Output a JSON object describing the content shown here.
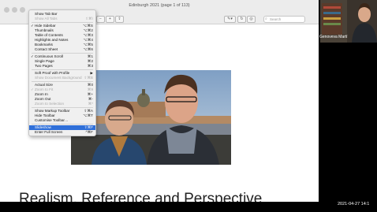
{
  "window": {
    "title": "Edinburgh 2021 (page 1 of 113)",
    "search_placeholder": "Search",
    "toolbar_pen": "✎▾"
  },
  "view_menu": {
    "items": [
      {
        "label": "Show Tab Bar",
        "shortcut": "",
        "checked": false,
        "disabled": false,
        "highlighted": false
      },
      {
        "label": "Show All Tabs",
        "shortcut": "⇧⌘\\",
        "checked": false,
        "disabled": true,
        "highlighted": false
      },
      {
        "label": "Hide Sidebar",
        "shortcut": "⌥⌘S",
        "checked": true,
        "disabled": false,
        "highlighted": false
      },
      {
        "label": "Thumbnails",
        "shortcut": "⌥⌘2",
        "checked": false,
        "disabled": false,
        "highlighted": false
      },
      {
        "label": "Table of Contents",
        "shortcut": "⌥⌘3",
        "checked": false,
        "disabled": false,
        "highlighted": false
      },
      {
        "label": "Highlights and Notes",
        "shortcut": "⌥⌘4",
        "checked": false,
        "disabled": false,
        "highlighted": false
      },
      {
        "label": "Bookmarks",
        "shortcut": "⌥⌘5",
        "checked": false,
        "disabled": false,
        "highlighted": false
      },
      {
        "label": "Contact Sheet",
        "shortcut": "⌥⌘6",
        "checked": false,
        "disabled": false,
        "highlighted": false
      },
      {
        "label": "Continuous Scroll",
        "shortcut": "⌘1",
        "checked": true,
        "disabled": false,
        "highlighted": false
      },
      {
        "label": "Single Page",
        "shortcut": "⌘2",
        "checked": false,
        "disabled": false,
        "highlighted": false
      },
      {
        "label": "Two Pages",
        "shortcut": "⌘3",
        "checked": false,
        "disabled": false,
        "highlighted": false
      },
      {
        "label": "Soft Proof with Profile",
        "shortcut": "▶",
        "checked": false,
        "disabled": false,
        "highlighted": false
      },
      {
        "label": "Show Document Background",
        "shortcut": "⇧⌘B",
        "checked": false,
        "disabled": true,
        "highlighted": false
      },
      {
        "label": "Actual Size",
        "shortcut": "⌘0",
        "checked": false,
        "disabled": false,
        "highlighted": false
      },
      {
        "label": "Zoom to Fit",
        "shortcut": "⌘9",
        "checked": true,
        "disabled": true,
        "highlighted": false
      },
      {
        "label": "Zoom In",
        "shortcut": "⌘+",
        "checked": false,
        "disabled": false,
        "highlighted": false
      },
      {
        "label": "Zoom Out",
        "shortcut": "⌘-",
        "checked": false,
        "disabled": false,
        "highlighted": false
      },
      {
        "label": "Zoom to Selection",
        "shortcut": "⌘*",
        "checked": false,
        "disabled": true,
        "highlighted": false
      },
      {
        "label": "Show Markup Toolbar",
        "shortcut": "⇧⌘A",
        "checked": false,
        "disabled": false,
        "highlighted": false
      },
      {
        "label": "Hide Toolbar",
        "shortcut": "⌥⌘T",
        "checked": false,
        "disabled": false,
        "highlighted": false
      },
      {
        "label": "Customise Toolbar…",
        "shortcut": "",
        "checked": false,
        "disabled": false,
        "highlighted": false
      },
      {
        "label": "Slideshow",
        "shortcut": "⇧⌘F",
        "checked": false,
        "disabled": false,
        "highlighted": true
      },
      {
        "label": "Enter Full Screen",
        "shortcut": "^⌘F",
        "checked": false,
        "disabled": false,
        "highlighted": false
      }
    ]
  },
  "slide": {
    "heading": "Realism, Reference and Perspective"
  },
  "video": {
    "participant_name": "Genoveva Martí",
    "timestamp": "2021-04-27  14:1"
  }
}
